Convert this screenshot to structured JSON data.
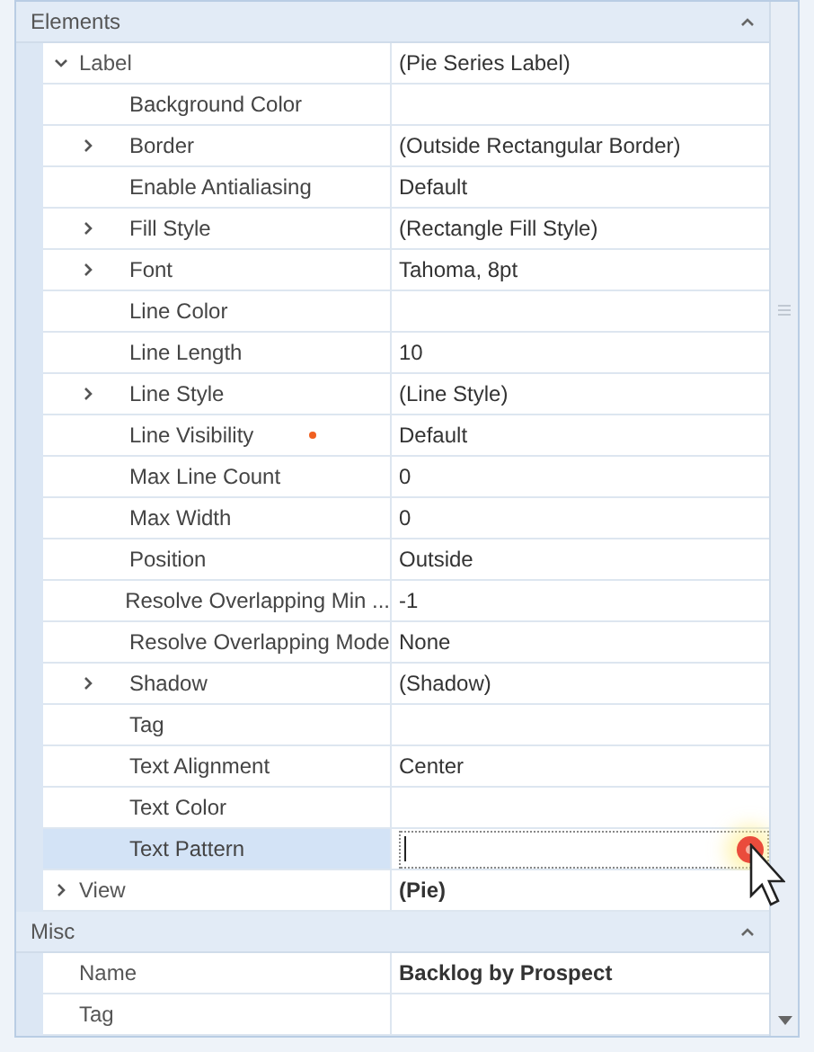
{
  "sections": [
    {
      "title": "Elements",
      "expanded": true,
      "rows": [
        {
          "name": "Label",
          "value": "(Pie Series Label)",
          "expanded": true,
          "children": [
            {
              "name": "Background Color"
            },
            {
              "name": "Border",
              "value": "(Outside Rectangular Border)",
              "expanded": false
            },
            {
              "name": "Enable Antialiasing",
              "value": "Default"
            },
            {
              "name": "Fill Style",
              "value": "(Rectangle Fill Style)",
              "expanded": false
            },
            {
              "name": "Font",
              "value": "Tahoma, 8pt",
              "expanded": false
            },
            {
              "name": "Line Color"
            },
            {
              "name": "Line Length",
              "value": "10"
            },
            {
              "name": "Line Style",
              "value": "(Line Style)",
              "expanded": false
            },
            {
              "name": "Line Visibility",
              "value": "Default",
              "modified": true
            },
            {
              "name": "Max Line Count",
              "value": "0"
            },
            {
              "name": "Max Width",
              "value": "0"
            },
            {
              "name": "Position",
              "value": "Outside"
            },
            {
              "name": "Resolve Overlapping Min ...",
              "value": "-1"
            },
            {
              "name": "Resolve Overlapping Mode",
              "value": "None"
            },
            {
              "name": "Shadow",
              "value": "(Shadow)",
              "expanded": false
            },
            {
              "name": "Tag"
            },
            {
              "name": "Text Alignment",
              "value": "Center"
            },
            {
              "name": "Text Color"
            },
            {
              "name": "Text Pattern",
              "selected": true,
              "editing": true
            }
          ]
        },
        {
          "name": "View",
          "value": "(Pie)",
          "bold": true,
          "expanded": false
        }
      ]
    },
    {
      "title": "Misc",
      "expanded": true,
      "rows": [
        {
          "name": "Name",
          "value": "Backlog by Prospect",
          "bold": true
        },
        {
          "name": "Tag"
        }
      ]
    }
  ]
}
